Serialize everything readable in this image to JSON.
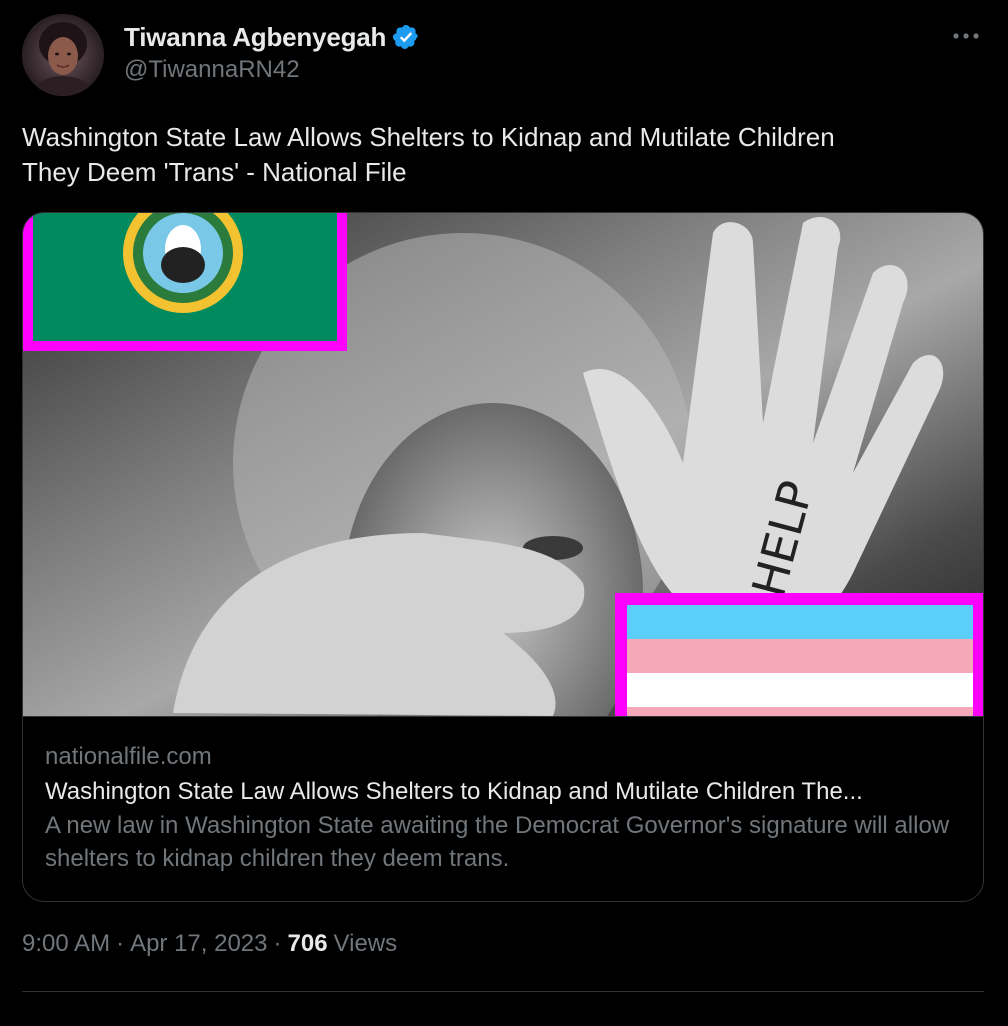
{
  "author": {
    "display_name": "Tiwanna Agbenyegah",
    "handle": "@TiwannaRN42",
    "verified": true
  },
  "tweet": {
    "text": "Washington State Law Allows Shelters to Kidnap and Mutilate Children\nThey Deem 'Trans' - National File"
  },
  "card": {
    "image_text": "HELP",
    "domain": "nationalfile.com",
    "title": "Washington State Law Allows Shelters to Kidnap and Mutilate Children The...",
    "description": "A new law in Washington State awaiting the Democrat Governor's signature will allow shelters to kidnap children they deem trans."
  },
  "meta": {
    "time": "9:00 AM",
    "separator": "·",
    "date": "Apr 17, 2023",
    "views_count": "706",
    "views_label": "Views"
  },
  "colors": {
    "background": "#000000",
    "text_primary": "#e7e9ea",
    "text_secondary": "#71767b",
    "border": "#2f3336",
    "verified_blue": "#1d9bf0",
    "flag_green": "#008a5e",
    "flag_magenta_border": "#ff00ff",
    "trans_blue": "#5bcefa",
    "trans_pink": "#f5a9b8",
    "trans_white": "#ffffff"
  },
  "icons": {
    "verified": "verified-badge-icon",
    "more": "more-horizontal-icon"
  }
}
